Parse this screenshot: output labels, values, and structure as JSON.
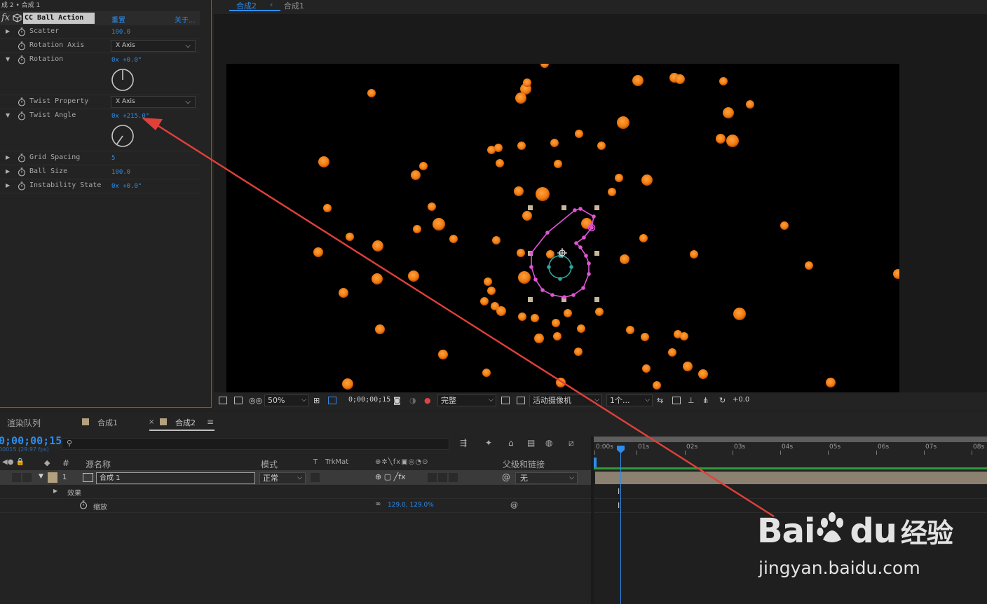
{
  "effect_controls": {
    "breadcrumb": "成 2 • 合成 1",
    "effect_name": "CC Ball Action",
    "reset": "重置",
    "about": "关于...",
    "properties": [
      {
        "label": "Scatter",
        "value": "100.0",
        "kind": "value",
        "twirl": "closed"
      },
      {
        "label": "Rotation Axis",
        "value": "X Axis",
        "kind": "dropdown",
        "twirl": "none"
      },
      {
        "label": "Rotation",
        "value": "0x +0.0°",
        "kind": "angle",
        "twirl": "open",
        "angle_deg": 0
      },
      {
        "label": "Twist Property",
        "value": "X Axis",
        "kind": "dropdown",
        "twirl": "none"
      },
      {
        "label": "Twist Angle",
        "value": "0x +215.0°",
        "kind": "angle",
        "twirl": "open",
        "angle_deg": 215
      },
      {
        "label": "Grid Spacing",
        "value": "5",
        "kind": "value",
        "twirl": "closed"
      },
      {
        "label": "Ball Size",
        "value": "100.0",
        "kind": "value",
        "twirl": "closed"
      },
      {
        "label": "Instability State",
        "value": "0x +0.0°",
        "kind": "value",
        "twirl": "closed"
      }
    ]
  },
  "composition": {
    "tab_active": "合成2",
    "tab_other": "合成1",
    "ball_color": "#f07a10"
  },
  "viewer_bar": {
    "zoom": "50%",
    "timecode": "0;00;00;15",
    "resolution": "完整",
    "camera": "活动摄像机",
    "views": "1个...",
    "exposure": "+0.0"
  },
  "timeline": {
    "tabs": {
      "render_queue": "渲染队列",
      "comp1": "合成1",
      "comp2": "合成2"
    },
    "timecode": "0;00;00;15",
    "fps": "00015 (29.97 fps)",
    "columns": {
      "number": "#",
      "source_name": "源名称",
      "mode": "模式",
      "t": "T",
      "trkmat": "TrkMat",
      "parent": "父级和链接"
    },
    "layer": {
      "number": "1",
      "name": "合成 1",
      "mode": "正常",
      "parent": "无"
    },
    "effects_label": "效果",
    "scale_label": "缩放",
    "scale_value": "129.0, 129.0%",
    "ruler": [
      "0:00s",
      "01s",
      "02s",
      "03s",
      "04s",
      "05s",
      "06s",
      "07s",
      "08s"
    ]
  },
  "watermark": {
    "brand": "Bai",
    "brand2": "du",
    "brand_cn": "经验",
    "url": "jingyan.baidu.com"
  },
  "annotation_color": "#e0403a"
}
